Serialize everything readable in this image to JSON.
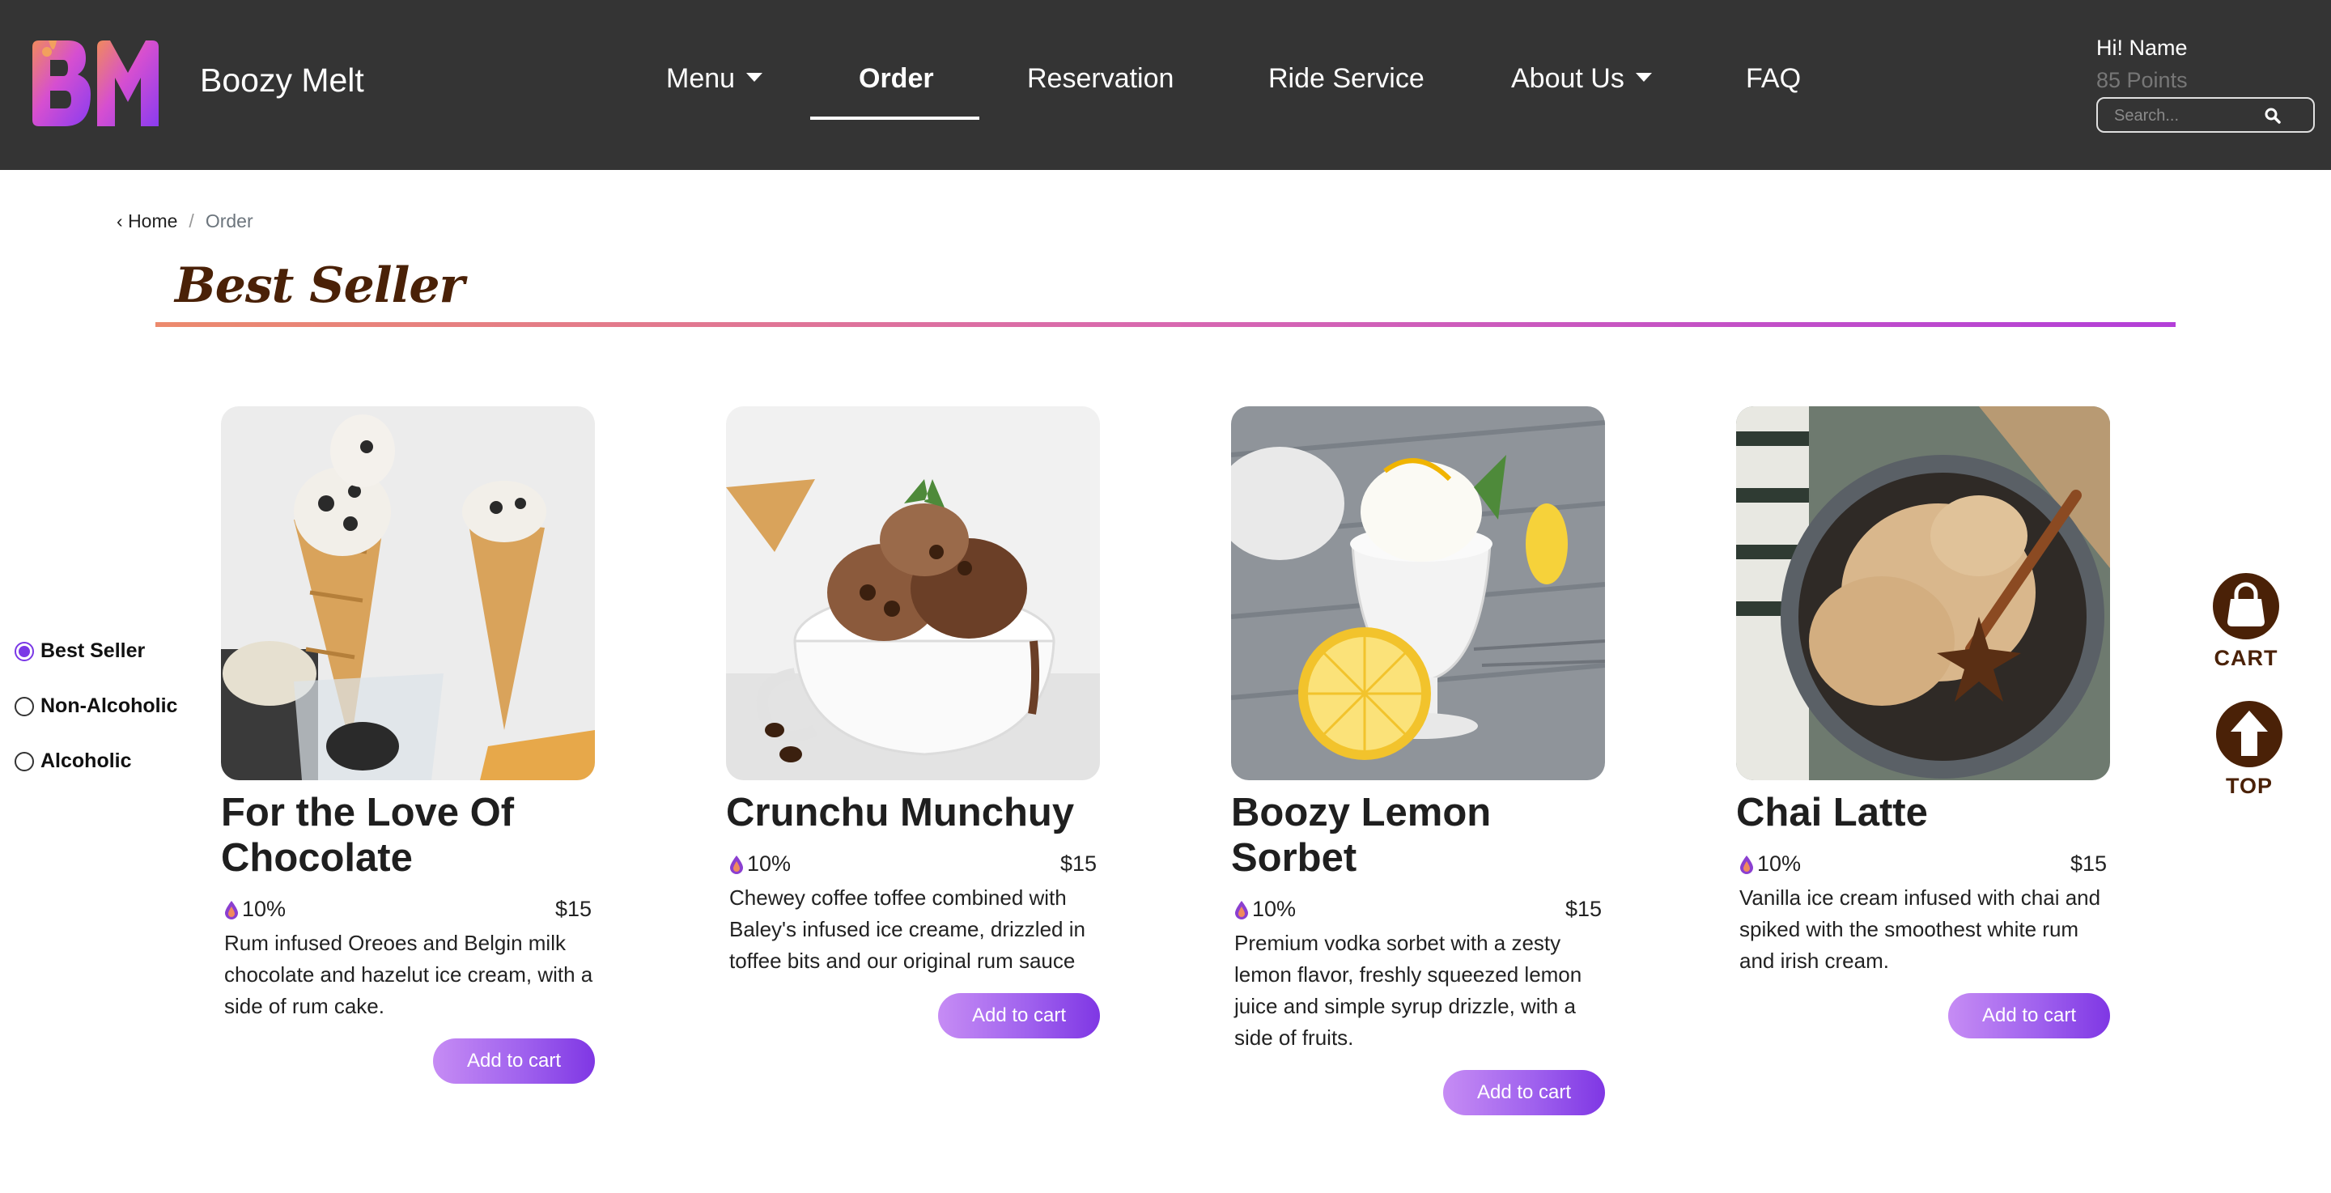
{
  "brand": {
    "name": "Boozy Melt",
    "logo_text": "BM"
  },
  "nav": {
    "items": [
      {
        "label": "Menu",
        "dropdown": true
      },
      {
        "label": "Order",
        "active": true
      },
      {
        "label": "Reservation"
      },
      {
        "label": "Ride Service"
      },
      {
        "label": "About Us",
        "dropdown": true
      },
      {
        "label": "FAQ"
      }
    ]
  },
  "user": {
    "greeting": "Hi! Name",
    "points": "85 Points"
  },
  "search": {
    "placeholder": "Search..."
  },
  "breadcrumb": {
    "home": "Home",
    "separator": "/",
    "current": "Order"
  },
  "section": {
    "title": "Best Seller"
  },
  "filters": [
    {
      "label": "Best Seller",
      "checked": true
    },
    {
      "label": "Non-Alcoholic",
      "checked": false
    },
    {
      "label": "Alcoholic",
      "checked": false
    }
  ],
  "products": [
    {
      "name": "For the Love Of Chocolate",
      "abv": "10%",
      "price": "$15",
      "description": "Rum infused Oreoes and Belgin milk chocolate and hazelut ice cream, with a side of rum cake.",
      "button": "Add to cart"
    },
    {
      "name": "Crunchu Munchuy",
      "abv": "10%",
      "price": "$15",
      "description": "Chewey coffee toffee combined with Baley's infused ice creame, drizzled in toffee bits and our original rum sauce",
      "button": "Add to cart"
    },
    {
      "name": "Boozy Lemon Sorbet",
      "abv": "10%",
      "price": "$15",
      "description": "Premium vodka sorbet with a zesty lemon flavor, freshly squeezed lemon juice and simple syrup drizzle, with a side of fruits.",
      "button": "Add to cart"
    },
    {
      "name": "Chai Latte",
      "abv": "10%",
      "price": "$15",
      "description": "Vanilla ice cream infused with chai and spiked with the smoothest white rum and irish cream.",
      "button": "Add to cart"
    }
  ],
  "floating": {
    "cart_label": "CART",
    "top_label": "TOP"
  },
  "colors": {
    "navbar": "#343434",
    "accent_purple": "#7f37e4",
    "brown": "#4a2107",
    "title_rule_start": "#ec8a6d",
    "title_rule_end": "#b33fd8"
  }
}
